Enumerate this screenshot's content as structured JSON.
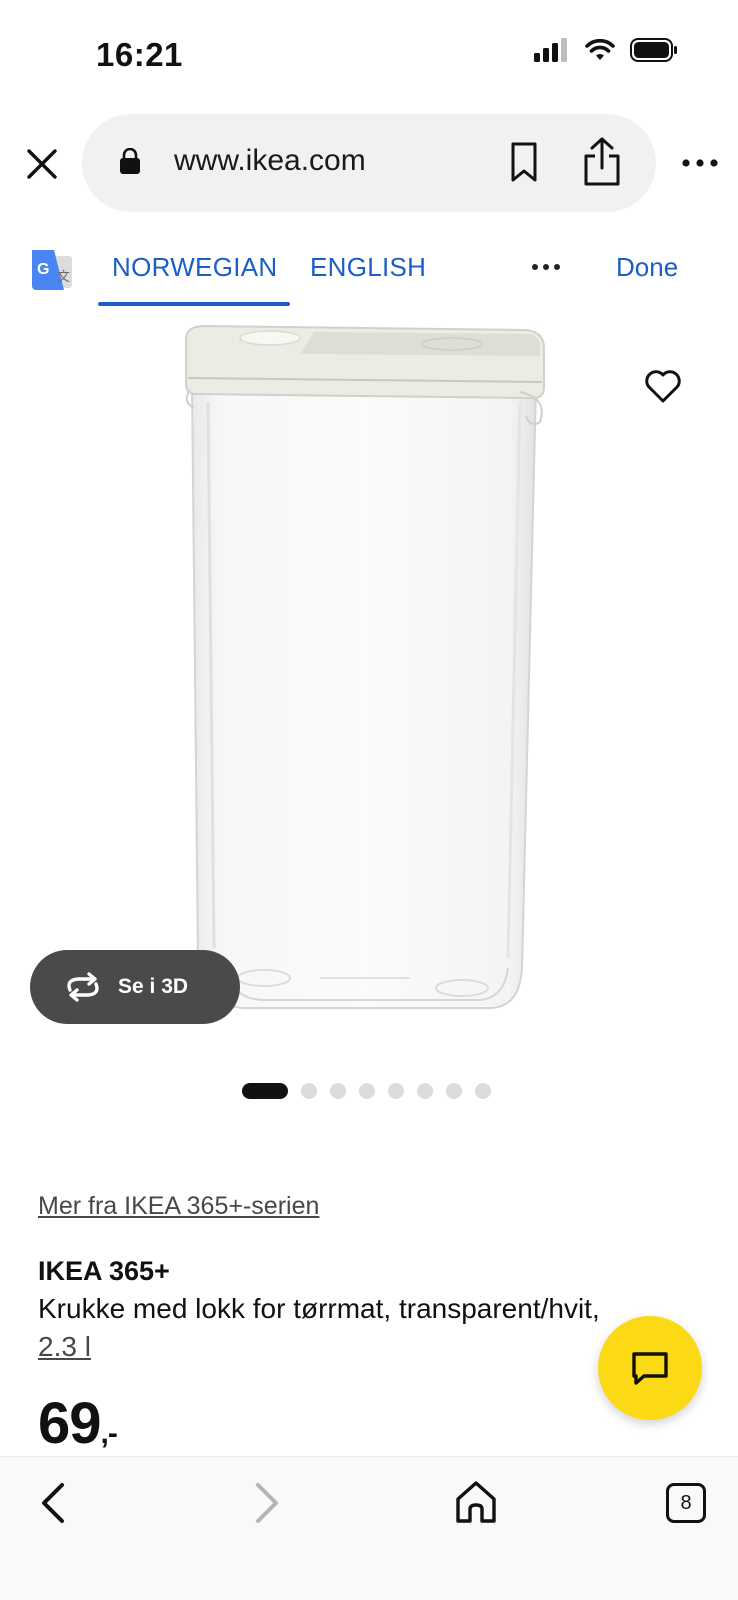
{
  "status_bar": {
    "time": "16:21"
  },
  "browser": {
    "url": "www.ikea.com"
  },
  "translate": {
    "tabs": [
      {
        "label": "NORWEGIAN",
        "active": true
      },
      {
        "label": "ENGLISH",
        "active": false
      }
    ],
    "done_label": "Done"
  },
  "product": {
    "view3d_label": "Se i 3D",
    "carousel": {
      "total": 8,
      "active_index": 0
    },
    "series_link": "Mer fra IKEA 365+-serien",
    "name": "IKEA 365+",
    "description": "Krukke med lokk for tørrmat, transparent/hvit,",
    "size": "2.3 l",
    "price": "69",
    "price_suffix": ",-"
  },
  "bottom_nav": {
    "tab_count": "8"
  },
  "colors": {
    "link_blue": "#1a5fc8",
    "chat_yellow": "#fbd914",
    "pill_gray": "#f0f1f3"
  }
}
